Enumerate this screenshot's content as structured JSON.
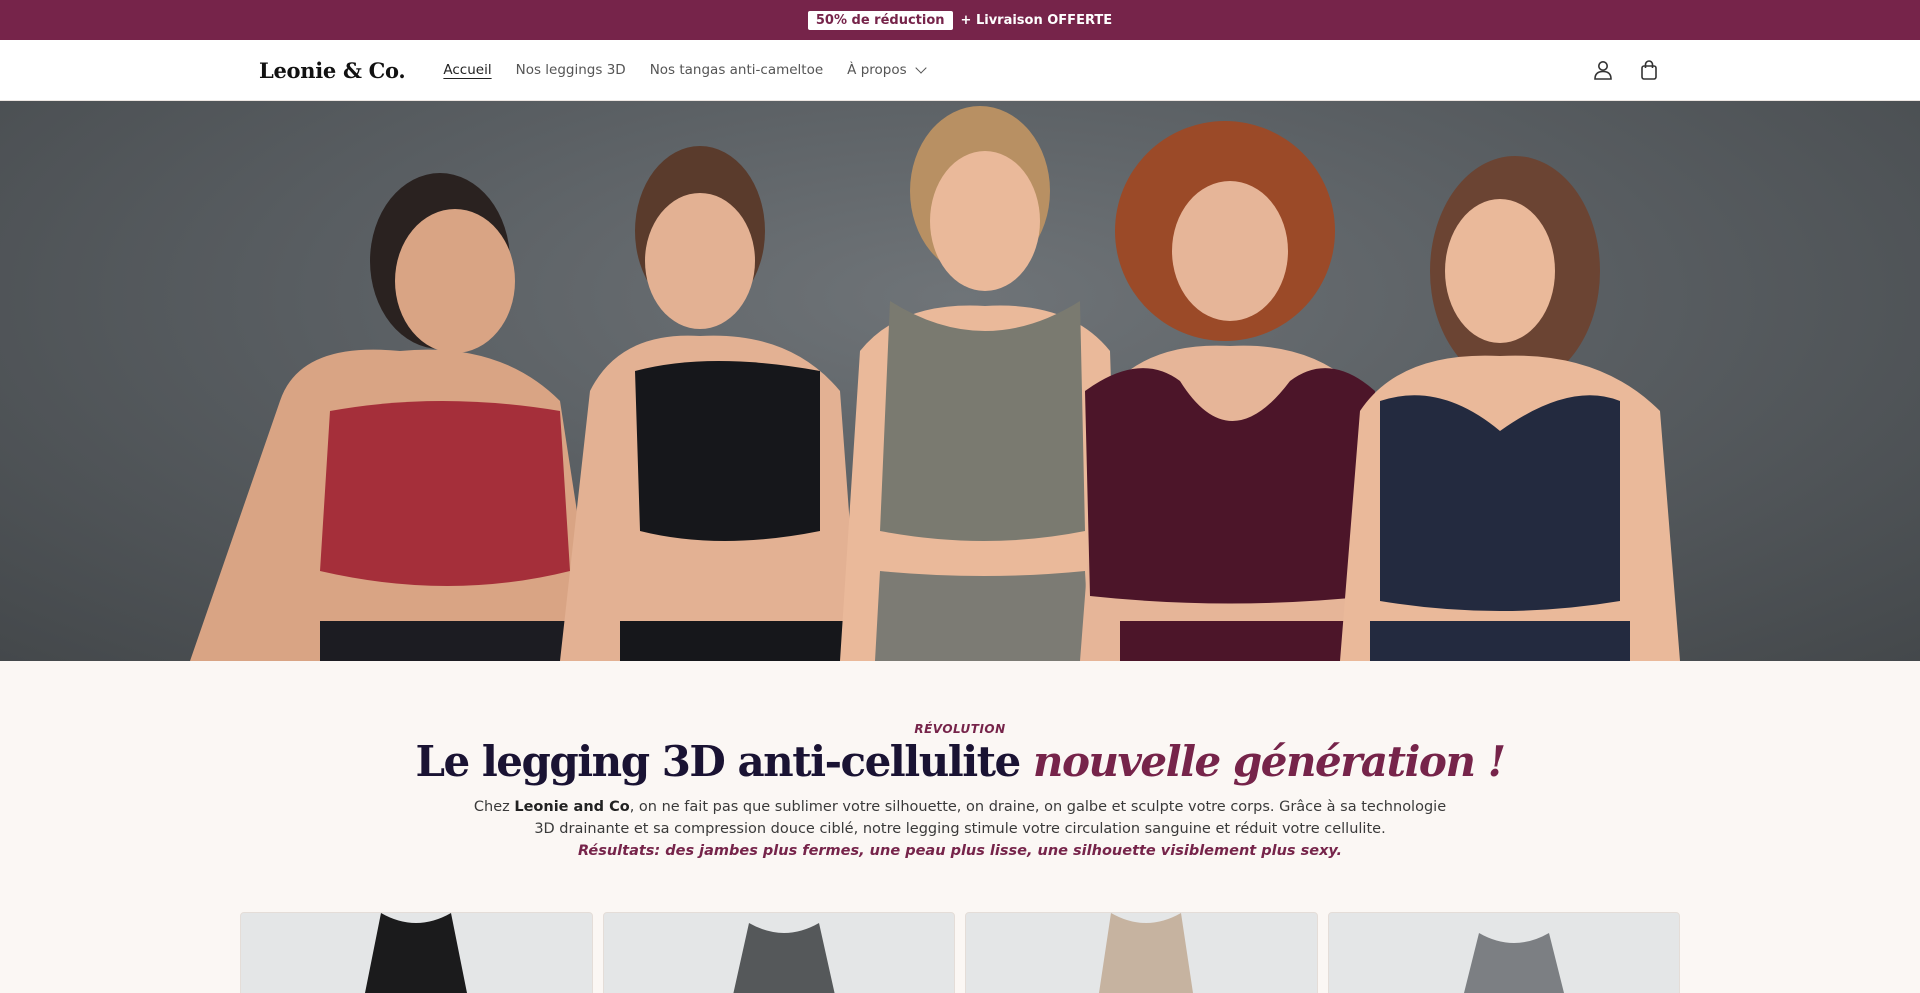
{
  "announcement": {
    "discount": "50% de réduction",
    "shipping": "+ Livraison OFFERTE"
  },
  "header": {
    "logo": "Leonie & Co.",
    "nav": [
      {
        "label": "Accueil",
        "active": true
      },
      {
        "label": "Nos leggings 3D",
        "active": false
      },
      {
        "label": "Nos tangas anti-cameltoe",
        "active": false
      },
      {
        "label": "À propos",
        "active": false,
        "has_dropdown": true
      }
    ],
    "icons": [
      "account-icon",
      "cart-icon"
    ]
  },
  "intro": {
    "eyebrow": "RÉVOLUTION",
    "headline_main": "Le legging 3D anti-cellulite",
    "headline_accent": "nouvelle génération !",
    "desc_prefix": "Chez ",
    "desc_brand": "Leonie and Co",
    "desc_body": ", on ne fait pas que sublimer votre silhouette, on draine, on galbe et sculpte votre corps. Grâce à sa technologie 3D drainante et sa compression douce ciblé, notre legging stimule votre circulation sanguine et réduit votre cellulite.",
    "results": "Résultats: des jambes plus fermes, une peau plus lisse, une silhouette visiblement plus sexy."
  },
  "products": [
    {
      "color": "#1b1b1c"
    },
    {
      "color": "#55585a"
    },
    {
      "color": "#c6b3a0"
    },
    {
      "color": "#7c7f83"
    }
  ],
  "colors": {
    "brand": "#76244a",
    "headline": "#1a1333",
    "background": "#fbf7f4"
  }
}
